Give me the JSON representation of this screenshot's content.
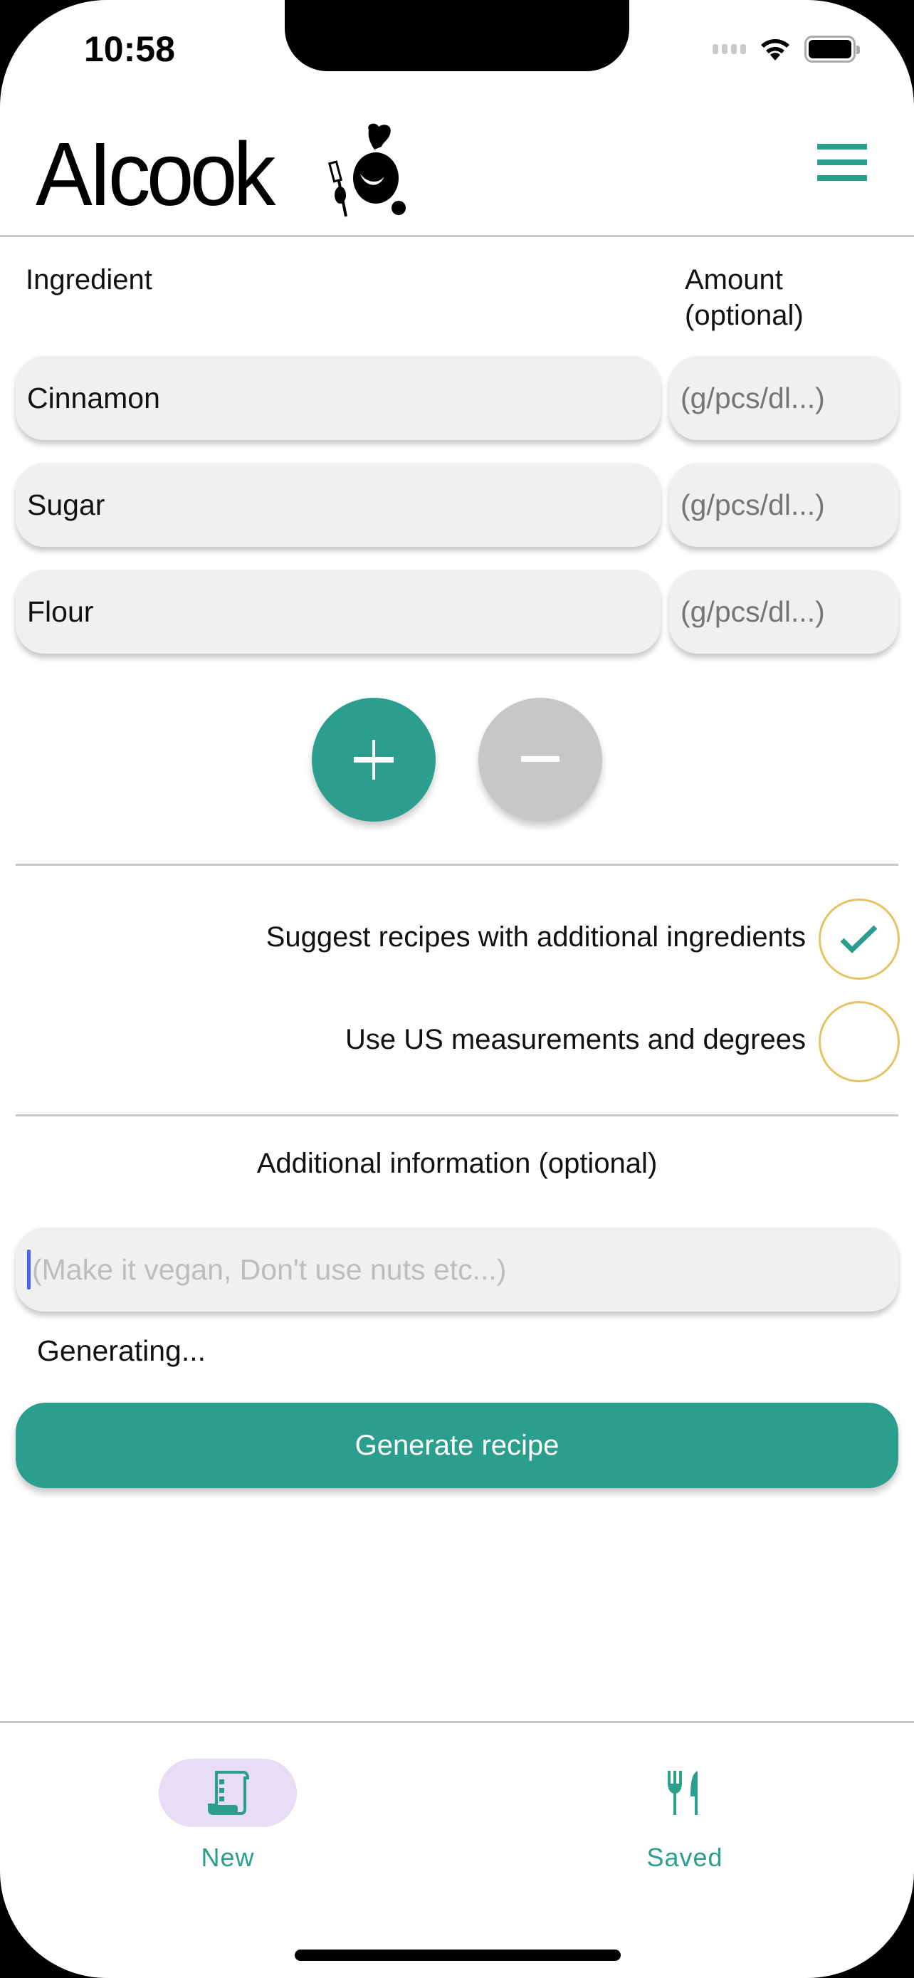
{
  "status_bar": {
    "time": "10:58"
  },
  "header": {
    "logo_text": "AIcook"
  },
  "ingredients": {
    "ingredient_header": "Ingredient",
    "amount_header_line1": "Amount",
    "amount_header_line2": "(optional)",
    "amount_placeholder": "(g/pcs/dl...)",
    "rows": [
      {
        "ingredient": "Cinnamon",
        "amount": ""
      },
      {
        "ingredient": "Sugar",
        "amount": ""
      },
      {
        "ingredient": "Flour",
        "amount": ""
      }
    ],
    "add_button_icon": "+",
    "remove_button_icon": "−"
  },
  "options": [
    {
      "label": "Suggest recipes with additional ingredients",
      "checked": true
    },
    {
      "label": "Use US measurements and degrees",
      "checked": false
    }
  ],
  "additional_info": {
    "label": "Additional information (optional)",
    "value": "",
    "placeholder": "(Make it vegan, Don't use nuts etc...)"
  },
  "status_text": "Generating...",
  "generate_button": {
    "label": "Generate recipe"
  },
  "tabbar": {
    "tabs": [
      {
        "label": "New",
        "icon": "receipt-icon",
        "active": true
      },
      {
        "label": "Saved",
        "icon": "utensils-icon",
        "active": false
      }
    ]
  },
  "colors": {
    "accent": "#2c9e8e",
    "checkbox_border": "#e6c465",
    "field_background": "#f0f0f0",
    "active_tab_pill": "#e7ddf4",
    "remove_button": "#c7c7c7"
  }
}
